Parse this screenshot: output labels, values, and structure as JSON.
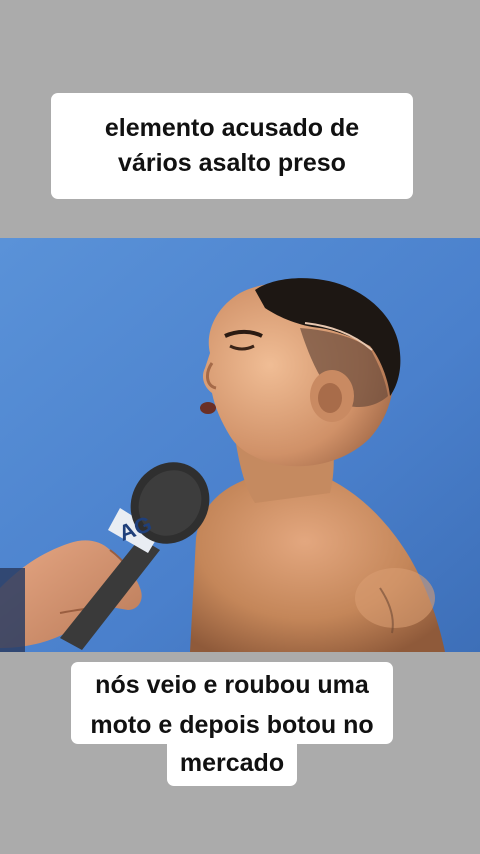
{
  "caption_top": "elemento acusado de\nvários asalto preso",
  "caption_bottom": {
    "line1": "nós veio e roubou uma",
    "line2": "moto e depois botou no",
    "line3": "mercado"
  },
  "photo": {
    "description_icons": [
      "man-figure",
      "microphone-icon",
      "hand"
    ],
    "mic_logo": "AG",
    "colors": {
      "wall": "#4d86cf",
      "skin": "#c88a62",
      "hair": "#1d1713",
      "mic": "#3a3a3a",
      "band": "#ababab"
    }
  }
}
